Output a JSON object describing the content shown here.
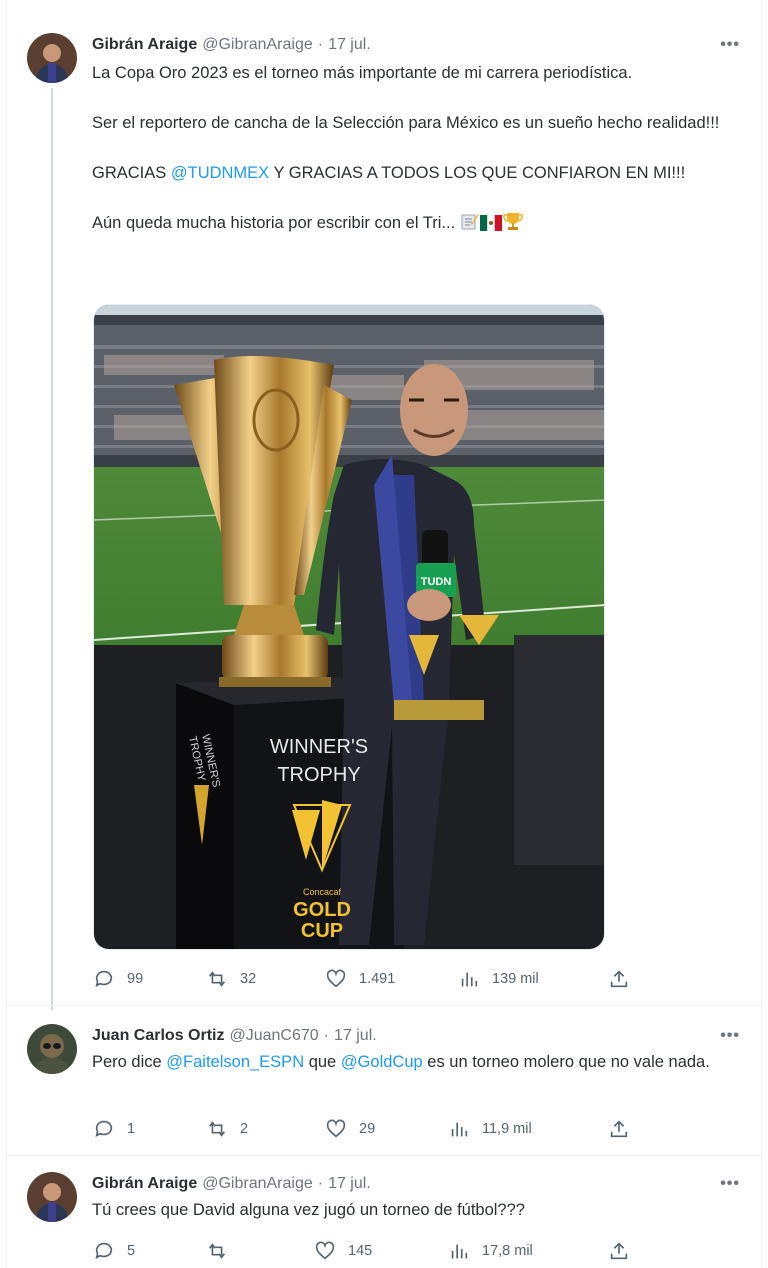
{
  "tweets": [
    {
      "name": "Gibrán Araige",
      "handle": "@GibranAraige",
      "sep": "·",
      "date": "17 jul.",
      "more": "•••",
      "text": {
        "line1": "La Copa Oro 2023 es el torneo más importante de mi carrera periodística.",
        "line2": "Ser el reportero de cancha de la Selección para México es un sueño hecho realidad!!!",
        "line3_a": "GRACIAS ",
        "line3_mention": "@TUDNMEX",
        "line3_b": " Y GRACIAS A TODOS LOS QUE CONFIARON EN MI!!!",
        "line4": "Aún queda mucha historia por escribir con el Tri...",
        "emojis": [
          "memo-emoji",
          "mexico-flag-emoji",
          "trophy-emoji"
        ]
      },
      "media": {
        "trophy_text_1": "WINNER'S",
        "trophy_text_2": "TROPHY",
        "side_text_1": "WINNER'S",
        "side_text_2": "TROPHY",
        "brand_small": "Concacaf",
        "brand_1": "GOLD",
        "brand_2": "CUP",
        "mic_label": "TUDN"
      },
      "stats": {
        "replies": "99",
        "retweets": "32",
        "likes": "1.491",
        "views": "139 mil"
      }
    },
    {
      "name": "Juan Carlos Ortiz",
      "handle": "@JuanC670",
      "sep": "·",
      "date": "17 jul.",
      "more": "•••",
      "text": {
        "a": "Pero dice ",
        "mention1": "@Faitelson_ESPN",
        "b": " que ",
        "mention2": "@GoldCup",
        "c": " es un torneo molero que no vale nada."
      },
      "stats": {
        "replies": "1",
        "retweets": "2",
        "likes": "29",
        "views": "11,9 mil"
      }
    },
    {
      "name": "Gibrán Araige",
      "handle": "@GibranAraige",
      "sep": "·",
      "date": "17 jul.",
      "more": "•••",
      "text": {
        "line1": "Tú crees que David alguna vez jugó un torneo de fútbol???"
      },
      "stats": {
        "replies": "5",
        "retweets": "",
        "likes": "145",
        "views": "17,8 mil"
      }
    }
  ],
  "colors": {
    "link": "#1d9bf0",
    "muted": "#536471",
    "text": "#0f1419"
  }
}
